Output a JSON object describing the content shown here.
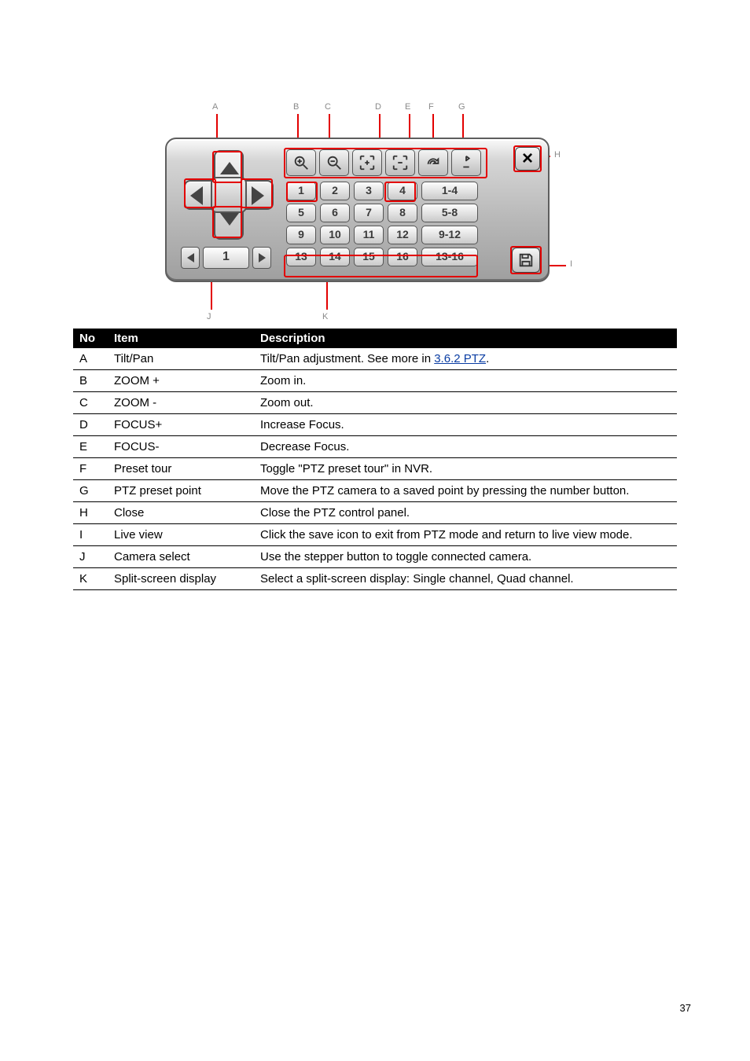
{
  "leaders": {
    "A_top": "A",
    "B_top": "B",
    "C_top": "C",
    "D_top": "D",
    "E_top": "E",
    "F_top": "F",
    "G_top": "G",
    "H_right": "H",
    "I_right": "I",
    "J_bottom": "J",
    "K_bottom": "K"
  },
  "panel": {
    "dpad": {
      "up": "▲",
      "down": "▼",
      "left": "◀",
      "right": "▶"
    },
    "spinner": {
      "prev": "◀",
      "value": "1",
      "next": "▶"
    },
    "tools": [
      "zoom-in",
      "zoom-out",
      "fit-whole",
      "fit-width",
      "undo",
      "upright"
    ],
    "channel_grid": [
      [
        "1",
        "2",
        "3",
        "4",
        "1-4"
      ],
      [
        "5",
        "6",
        "7",
        "8",
        "5-8"
      ],
      [
        "9",
        "10",
        "11",
        "12",
        "9-12"
      ],
      [
        "13",
        "14",
        "15",
        "16",
        "13-16"
      ]
    ],
    "close_label": "×",
    "save_label": ""
  },
  "table": {
    "headers": [
      "No",
      "Item",
      "Description"
    ],
    "rows": [
      {
        "no": "A",
        "item": "Tilt/Pan",
        "desc_pre": "Tilt/Pan adjustment. See more in ",
        "desc_link": "3.6.2 PTZ",
        "desc_post": "."
      },
      {
        "no": "B",
        "item": "ZOOM +",
        "desc": "Zoom in."
      },
      {
        "no": "C",
        "item": "ZOOM -",
        "desc": "Zoom out."
      },
      {
        "no": "D",
        "item": "FOCUS+",
        "desc": "Increase Focus."
      },
      {
        "no": "E",
        "item": "FOCUS-",
        "desc": "Decrease Focus."
      },
      {
        "no": "F",
        "item": "Preset tour",
        "desc": "Toggle \"PTZ preset tour\" in NVR."
      },
      {
        "no": "G",
        "item": "PTZ preset point",
        "desc": "Move the PTZ camera to a saved point by pressing the number button."
      },
      {
        "no": "H",
        "item": "Close",
        "desc": "Close the PTZ control panel."
      },
      {
        "no": "I",
        "item": "Live view",
        "desc": "Click the save icon to exit from PTZ mode and return to live view mode."
      },
      {
        "no": "J",
        "item": "Camera select",
        "desc": "Use the stepper button to toggle connected camera."
      },
      {
        "no": "K",
        "item": "Split-screen display",
        "desc": "Select a split-screen display: Single channel, Quad channel."
      }
    ]
  },
  "page_number": "37"
}
